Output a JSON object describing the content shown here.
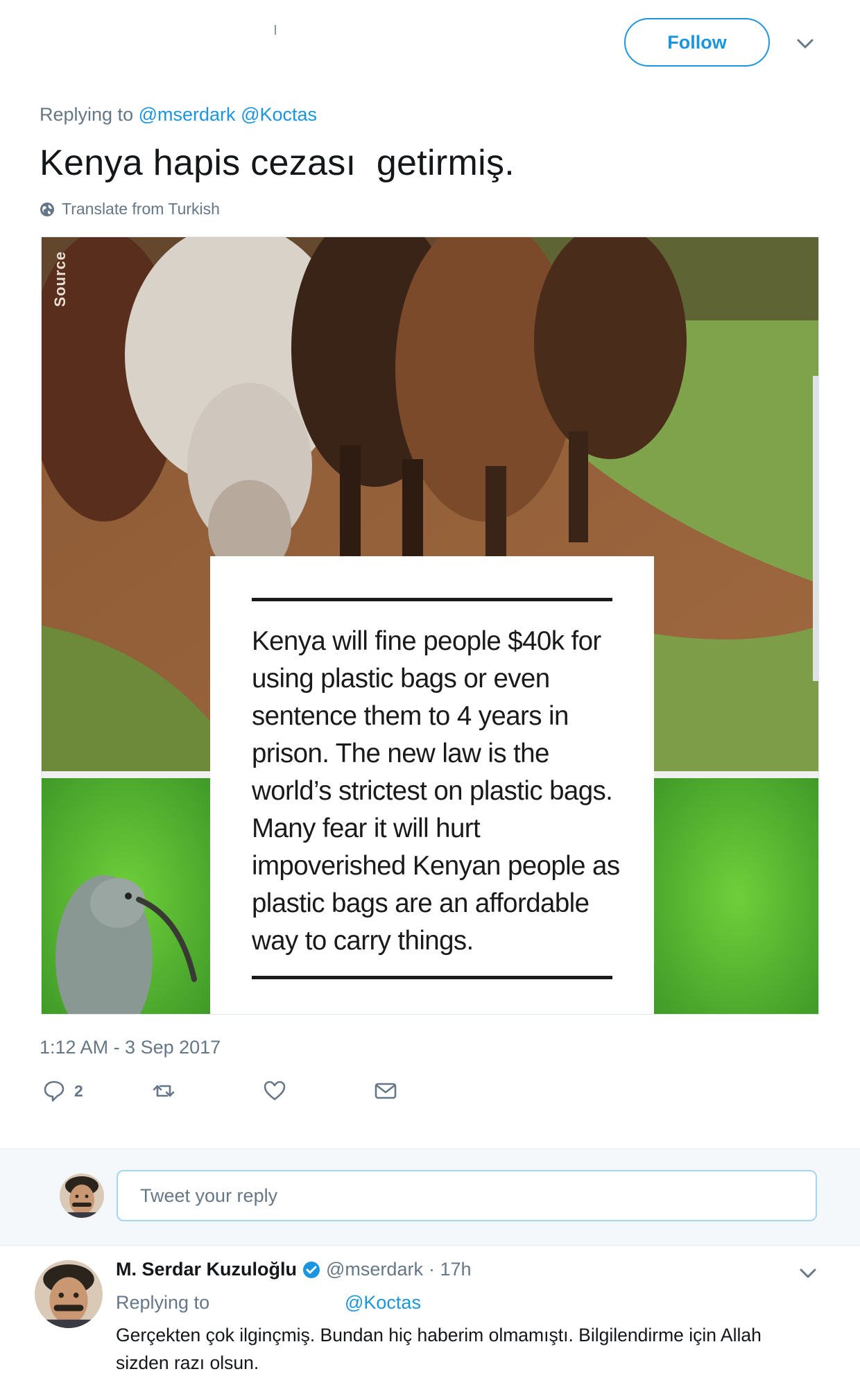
{
  "header": {
    "follow_label": "Follow",
    "caret_icon": "chevron-down-icon"
  },
  "tweet": {
    "replying_prefix": "Replying to",
    "replying_mentions": [
      "@mserdark",
      "@Koctas"
    ],
    "text": "Kenya hapis cezası  getirmiş.",
    "translate_label": "Translate from Turkish",
    "timestamp": "1:12 AM - 3 Sep 2017",
    "media": {
      "source_label": "Source",
      "card_text": "Kenya will fine people $40k for using plastic bags or even sentence them to 4 years in prison. The new law is the world’s strictest on plastic bags. Many fear it will hurt impoverished Kenyan people as plastic bags are an affordable way to carry things."
    },
    "actions": {
      "reply_count": "2",
      "reply_icon": "reply-icon",
      "retweet_icon": "retweet-icon",
      "like_icon": "heart-icon",
      "dm_icon": "envelope-icon"
    }
  },
  "reply_box": {
    "placeholder": "Tweet your reply"
  },
  "reply_tweet": {
    "name": "M. Serdar Kuzuloğlu",
    "handle": "@mserdark",
    "time": "· 17h",
    "replying_prefix": "Replying to",
    "replying_mention": "@Koctas",
    "text": "Gerçekten çok ilginçmiş. Bundan hiç haberim olmamıştı. Bilgilendirme için Allah sizden razı olsun."
  },
  "colors": {
    "accent": "#1b95e0",
    "secondary_text": "#657786",
    "primary_text": "#14171a",
    "reply_bg": "#f5f8fa"
  }
}
